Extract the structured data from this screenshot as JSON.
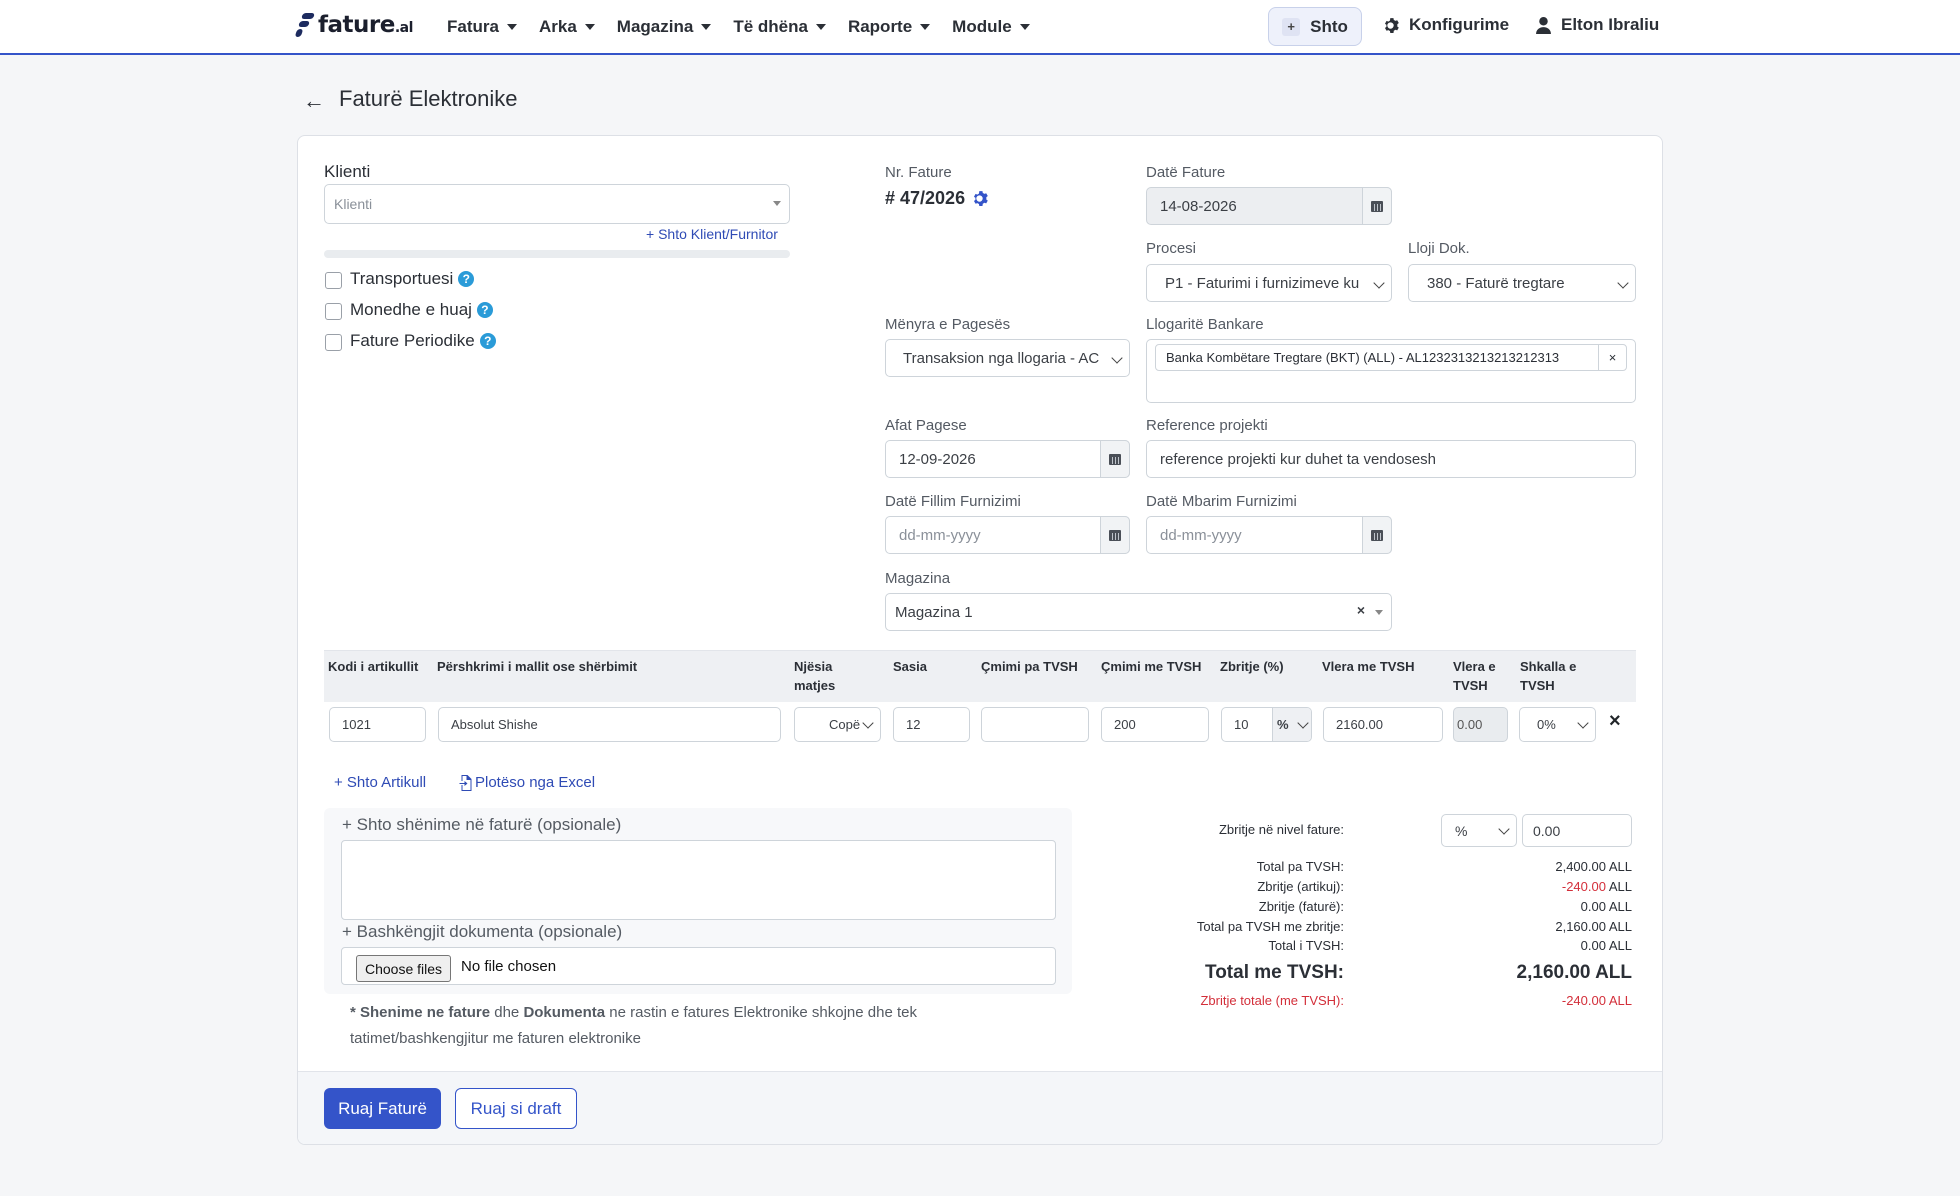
{
  "nav": {
    "brand": "fature",
    "brand_suffix": ".al",
    "menu": [
      "Fatura",
      "Arka",
      "Magazina",
      "Të dhëna",
      "Raporte",
      "Module"
    ],
    "add_label": "Shto",
    "config_label": "Konfigurime",
    "user_name": "Elton Ibraliu"
  },
  "page": {
    "title": "Faturë Elektronike"
  },
  "client": {
    "label": "Klienti",
    "placeholder": "Klienti",
    "add_link": "+ Shto Klient/Furnitor",
    "options": [
      "Transportuesi",
      "Monedhe e huaj",
      "Fature Periodike"
    ]
  },
  "invoice": {
    "nr_label": "Nr. Fature",
    "nr_value": "# 47/2026",
    "date_label": "Datë Fature",
    "date_value": "14-08-2026",
    "process_label": "Procesi",
    "process_value": "P1 - Faturimi i furnizimeve ku",
    "doc_type_label": "Lloji Dok.",
    "doc_type_value": "380 - Faturë tregtare",
    "payment_method_label": "Mënyra e Pagesës",
    "payment_method_value": "Transaksion nga llogaria - AC",
    "bank_label": "Llogaritë Bankare",
    "bank_value": "Banka Kombëtare Tregtare (BKT) (ALL) - AL1232313213213212313",
    "due_label": "Afat Pagese",
    "due_value": "12-09-2026",
    "project_ref_label": "Reference projekti",
    "project_ref_value": "reference projekti kur duhet ta vendosesh",
    "supply_start_label": "Datë Fillim Furnizimi",
    "supply_start_placeholder": "dd-mm-yyyy",
    "supply_end_label": "Datë Mbarim Furnizimi",
    "supply_end_placeholder": "dd-mm-yyyy",
    "warehouse_label": "Magazina",
    "warehouse_value": "Magazina 1"
  },
  "table": {
    "headers": {
      "code": "Kodi i artikullit",
      "desc": "Përshkrimi i mallit ose shërbimit",
      "unit_1": "Njësia",
      "unit_2": "matjes",
      "qty": "Sasia",
      "price_excl": "Çmimi pa TVSH",
      "price_incl": "Çmimi me TVSH",
      "discount": "Zbritje (%)",
      "value_incl": "Vlera me TVSH",
      "vat_value_1": "Vlera e",
      "vat_value_2": "TVSH",
      "vat_rate_1": "Shkalla e",
      "vat_rate_2": "TVSH"
    },
    "row": {
      "code": "1021",
      "desc": "Absolut Shishe",
      "unit": "Copë",
      "qty": "12",
      "price_excl": "",
      "price_incl": "200",
      "discount": "10",
      "discount_type": "%",
      "value_incl": "2160.00",
      "vat_value": "0.00",
      "vat_rate": "0%"
    },
    "add_item": "+ Shto Artikull",
    "fill_excel": "Plotëso nga Excel"
  },
  "notes": {
    "notes_label": "+ Shto shënime në faturë (opsionale)",
    "attach_label": "+ Bashkëngjit dokumenta (opsionale)",
    "choose_files": "Choose files",
    "no_file": "No file chosen",
    "hint_star": "* ",
    "hint_b1": "Shenime ne fature",
    "hint_t1": " dhe ",
    "hint_b2": "Dokumenta",
    "hint_t2": " ne rastin e fatures Elektronike shkojne dhe tek",
    "hint_line2": "tatimet/bashkengjitur me faturen elektronike"
  },
  "summary": {
    "invoice_discount_label": "Zbritje në nivel fature:",
    "invoice_discount_type": "%",
    "invoice_discount_value": "0.00",
    "rows": [
      {
        "label": "Total pa TVSH:",
        "value": "2,400.00 ALL"
      },
      {
        "label": "Zbritje (artikuj):",
        "value_red": "-240.00",
        "value_suffix": " ALL"
      },
      {
        "label": "Zbritje (faturë):",
        "value": "0.00 ALL"
      },
      {
        "label": "Total pa TVSH me zbritje:",
        "value": "2,160.00 ALL"
      },
      {
        "label": "Total i TVSH:",
        "value": "0.00 ALL"
      }
    ],
    "total_label": "Total me TVSH:",
    "total_value": "2,160.00 ALL",
    "total_discount_label": "Zbritje totale (me TVSH):",
    "total_discount_value": "-240.00 ALL"
  },
  "actions": {
    "save": "Ruaj Faturë",
    "save_draft": "Ruaj si draft"
  },
  "colors": {
    "primary": "#3454c9",
    "danger": "#d32f3a",
    "help": "#2a9bd8"
  }
}
